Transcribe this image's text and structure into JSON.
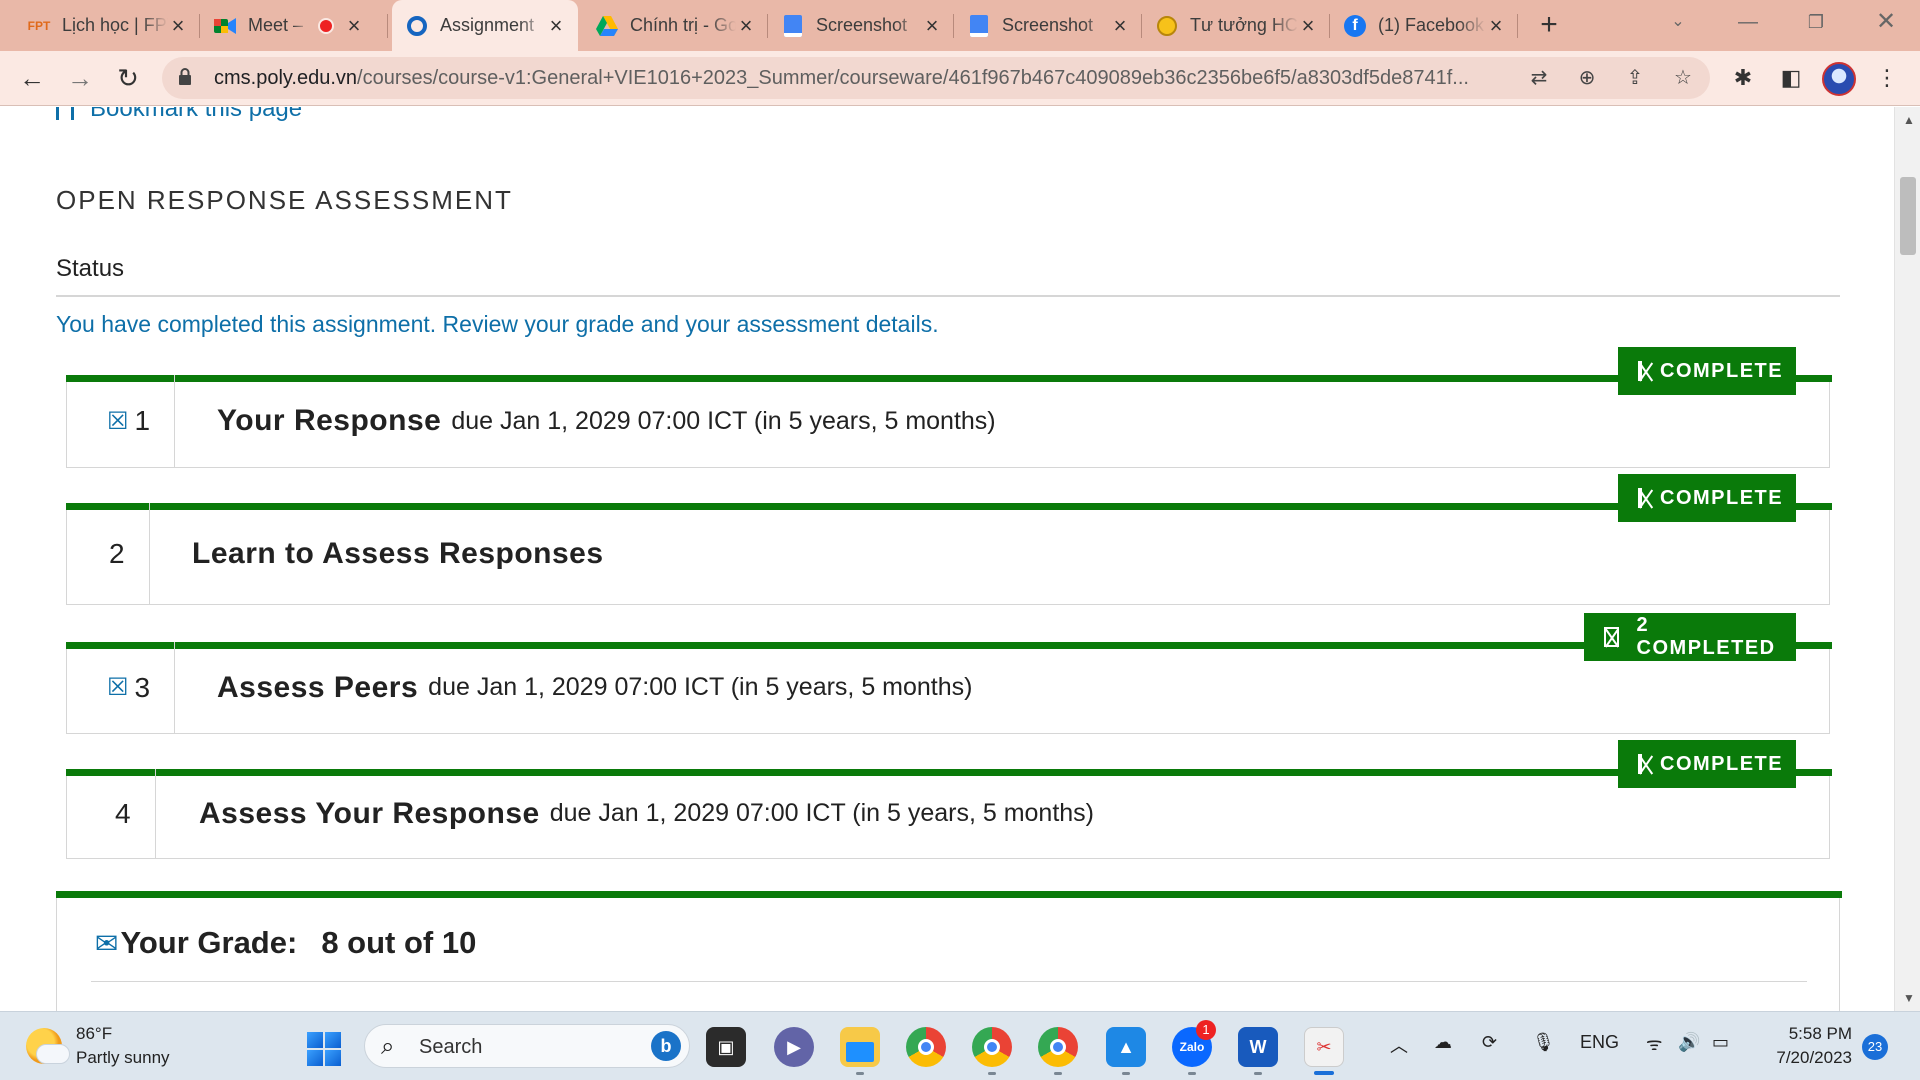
{
  "browser": {
    "tabs": [
      {
        "title": "Lịch học | FPT",
        "favicon": "fpt-logo-icon"
      },
      {
        "title": "Meet –",
        "favicon": "meet-icon",
        "recording": true
      },
      {
        "title": "Assignment",
        "favicon": "circle-o-icon",
        "active": true
      },
      {
        "title": "Chính trị - Google Drive",
        "favicon": "drive-icon"
      },
      {
        "title": "Screenshot",
        "favicon": "docs-icon"
      },
      {
        "title": "Screenshot",
        "favicon": "docs-icon"
      },
      {
        "title": "Tư tưởng HCM",
        "favicon": "emoji-icon"
      },
      {
        "title": "(1) Facebook",
        "favicon": "facebook-icon"
      }
    ],
    "new_tab": "+",
    "url_host": "cms.poly.edu.vn",
    "url_path": "/courses/course-v1:General+VIE1016+2023_Summer/courseware/461f967b467c409089eb36c2356be6f5/a8303df5de8741f..."
  },
  "page": {
    "bookmark_label": "Bookmark this page",
    "heading": "OPEN RESPONSE ASSESSMENT",
    "status_title": "Status",
    "status_message": "You have completed this assignment. Review your grade and your assessment details.",
    "steps": [
      {
        "number": "1",
        "has_icon": true,
        "name": "Your Response",
        "due": "due Jan 1, 2029 07:00 ICT (in 5 years, 5 months)",
        "badge": "COMPLETE"
      },
      {
        "number": "2",
        "has_icon": false,
        "name": "Learn to Assess Responses",
        "due": "",
        "badge": "COMPLETE"
      },
      {
        "number": "3",
        "has_icon": true,
        "name": "Assess Peers",
        "due": "due Jan 1, 2029 07:00 ICT (in 5 years, 5 months)",
        "badge": "2 COMPLETED"
      },
      {
        "number": "4",
        "has_icon": false,
        "name": "Assess Your Response",
        "due": "due Jan 1, 2029 07:00 ICT (in 5 years, 5 months)",
        "badge": "COMPLETE"
      }
    ],
    "grade_label": "Your Grade:",
    "grade_value": "8 out of 10"
  },
  "taskbar": {
    "weather_temp": "86°F",
    "weather_desc": "Partly sunny",
    "search_placeholder": "Search",
    "zalo_badge": "1",
    "language": "ENG",
    "time": "5:58 PM",
    "date": "7/20/2023",
    "notifications": "23"
  },
  "colors": {
    "accent_green": "#0a7a0a",
    "link_blue": "#0e6fa8",
    "tab_strip": "#e9b8a8"
  }
}
